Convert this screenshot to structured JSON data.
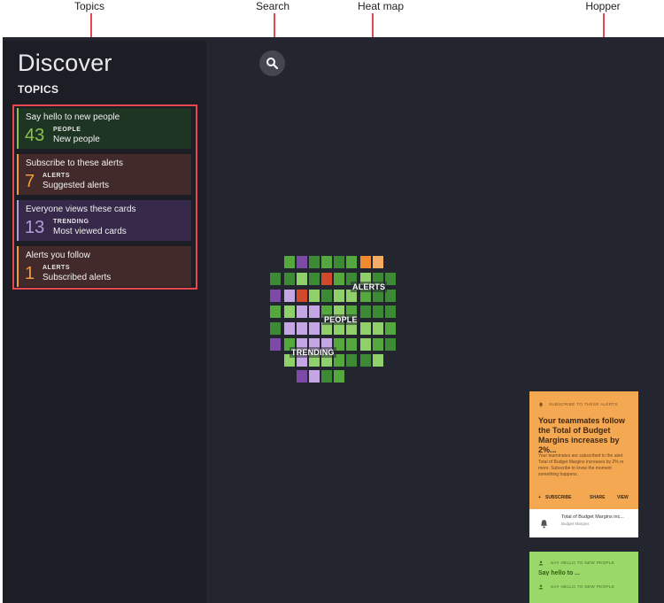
{
  "callouts": {
    "topics": "Topics",
    "search": "Search",
    "heatmap": "Heat map",
    "hopper": "Hopper"
  },
  "app": {
    "title": "Discover",
    "topics_heading": "TOPICS"
  },
  "topics": [
    {
      "title": "Say hello to new people",
      "count": "43",
      "category": "PEOPLE",
      "subtitle": "New people",
      "accent": "#8bc34a",
      "bg": "#1f3524"
    },
    {
      "title": "Subscribe to these alerts",
      "count": "7",
      "category": "ALERTS",
      "subtitle": "Suggested alerts",
      "accent": "#f39c38",
      "bg": "#42292a"
    },
    {
      "title": "Everyone views these cards",
      "count": "13",
      "category": "TRENDING",
      "subtitle": "Most viewed cards",
      "accent": "#b39ddb",
      "bg": "#36294a"
    },
    {
      "title": "Alerts you follow",
      "count": "1",
      "category": "ALERTS",
      "subtitle": "Subscribed alerts",
      "accent": "#f39c38",
      "bg": "#42292a"
    }
  ],
  "search": {
    "icon": "search-icon"
  },
  "heatmap": {
    "labels": {
      "alerts": "ALERTS",
      "people": "PEOPLE",
      "trending": "TRENDING"
    },
    "colors": {
      "dg": "#3d8a34",
      "g": "#55a83e",
      "lg": "#8fd06a",
      "p": "#7e4aa8",
      "lp": "#c5a6e4",
      "o": "#f08a2c",
      "lo": "#f4ad62",
      "r": "#d1482a"
    }
  },
  "hopper": {
    "card": {
      "header": "SUBSCRIBE TO THESE ALERTS",
      "title": "Your teammates follow the Total of Budget Margins increases by 2%...",
      "body": "Your teammates are subscribed to the alert Total of Budget Margins increases by 2% or more. Subscribe to know the moment something happens.",
      "actions": {
        "subscribe": "SUBSCRIBE",
        "share": "SHARE",
        "view": "VIEW"
      },
      "footer_title": "Total of Budget Margins inc...",
      "footer_subtitle": "Budget Margins"
    },
    "stack": [
      {
        "header": "SAY HELLO TO NEW PEOPLE",
        "peek": "Say hello to ..."
      },
      {
        "header": "SAY HELLO TO NEW PEOPLE",
        "peek": ""
      }
    ]
  }
}
